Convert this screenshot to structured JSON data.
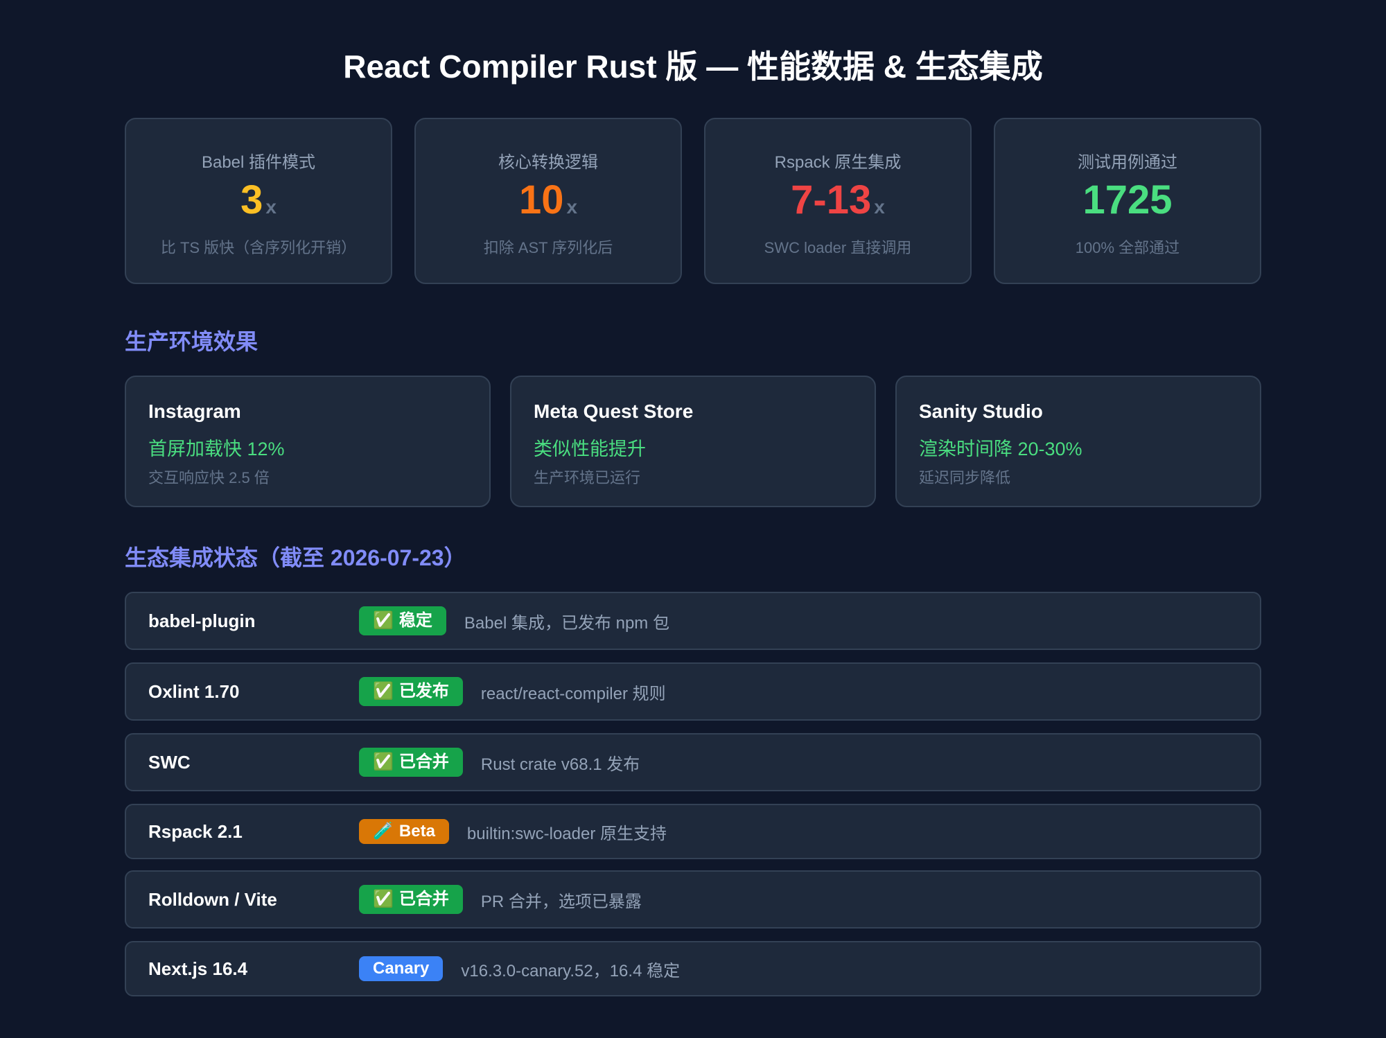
{
  "title": "React Compiler Rust 版 — 性能数据 & 生态集成",
  "stats": [
    {
      "label": "Babel 插件模式",
      "value": "3",
      "unit": "x",
      "sub": "比 TS 版快（含序列化开销）",
      "color": "#fbbf24"
    },
    {
      "label": "核心转换逻辑",
      "value": "10",
      "unit": "x",
      "sub": "扣除 AST 序列化后",
      "color": "#f97316"
    },
    {
      "label": "Rspack 原生集成",
      "value": "7-13",
      "unit": "x",
      "sub": "SWC loader 直接调用",
      "color": "#ef4444"
    },
    {
      "label": "测试用例通过",
      "value": "1725",
      "unit": "",
      "sub": "100% 全部通过",
      "color": "#4ade80"
    }
  ],
  "production": {
    "heading": "生产环境效果",
    "items": [
      {
        "name": "Instagram",
        "metric": "首屏加载快 12%",
        "sub": "交互响应快 2.5 倍"
      },
      {
        "name": "Meta Quest Store",
        "metric": "类似性能提升",
        "sub": "生产环境已运行"
      },
      {
        "name": "Sanity Studio",
        "metric": "渲染时间降 20-30%",
        "sub": "延迟同步降低"
      }
    ]
  },
  "ecosystem": {
    "heading": "生态集成状态（截至 2026-07-23）",
    "rows": [
      {
        "name": "babel-plugin",
        "icon": "✅",
        "badge": "稳定",
        "badge_color": "#16a34a",
        "desc": "Babel 集成，已发布 npm 包"
      },
      {
        "name": "Oxlint 1.70",
        "icon": "✅",
        "badge": "已发布",
        "badge_color": "#16a34a",
        "desc": "react/react-compiler 规则"
      },
      {
        "name": "SWC",
        "icon": "✅",
        "badge": "已合并",
        "badge_color": "#16a34a",
        "desc": "Rust crate v68.1 发布"
      },
      {
        "name": "Rspack 2.1",
        "icon": "🧪",
        "badge": "Beta",
        "badge_color": "#d97706",
        "desc": "builtin:swc-loader 原生支持"
      },
      {
        "name": "Rolldown / Vite",
        "icon": "✅",
        "badge": "已合并",
        "badge_color": "#16a34a",
        "desc": "PR 合并，选项已暴露"
      },
      {
        "name": "Next.js 16.4",
        "icon": "",
        "badge": "Canary",
        "badge_color": "#3b82f6",
        "desc": "v16.3.0-canary.52，16.4 稳定"
      }
    ]
  }
}
